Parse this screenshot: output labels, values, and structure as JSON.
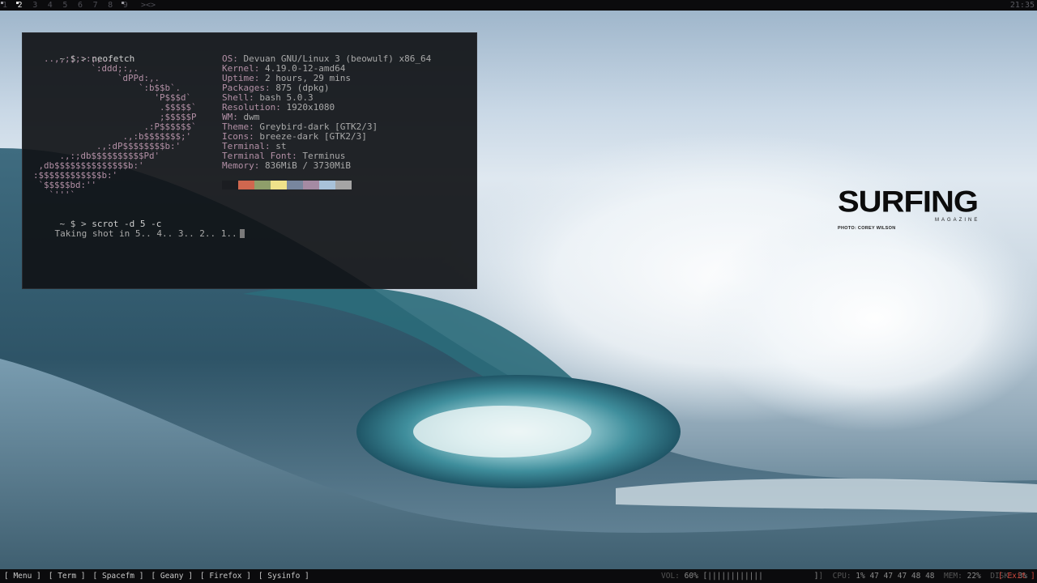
{
  "topbar": {
    "tags": [
      "1",
      "2",
      "3",
      "4",
      "5",
      "6",
      "7",
      "8",
      "9"
    ],
    "active_tag": "2",
    "layout_symbol": "><>",
    "clock": "21:35"
  },
  "wallpaper": {
    "brand": "SURFING",
    "brand_sub": "MAGAZINE",
    "credit": "PHOTO: COREY WILSON"
  },
  "terminal": {
    "prompt": {
      "tilde": "~",
      "dollar": "$",
      "arrow": ">"
    },
    "command1": "neofetch",
    "ascii_art": "  ..,,;;;::;,..\n           `:ddd;:,.\n                `dPPd:,.\n                    `:b$$b`.\n                       'P$$$d`\n                        .$$$$$`\n                        ;$$$$$P\n                     .:P$$$$$$`\n                 .,:b$$$$$$$;'\n            .,:dP$$$$$$$$b:'\n     .,:;db$$$$$$$$$$Pd'\n ,db$$$$$$$$$$$$$$b:'\n:$$$$$$$$$$$$b:'\n `$$$$$bd:''\n   `'''`",
    "info": [
      {
        "key": "OS",
        "value": "Devuan GNU/Linux 3 (beowulf) x86_64"
      },
      {
        "key": "Kernel",
        "value": "4.19.0-12-amd64"
      },
      {
        "key": "Uptime",
        "value": "2 hours, 29 mins"
      },
      {
        "key": "Packages",
        "value": "875 (dpkg)"
      },
      {
        "key": "Shell",
        "value": "bash 5.0.3"
      },
      {
        "key": "Resolution",
        "value": "1920x1080"
      },
      {
        "key": "WM",
        "value": "dwm"
      },
      {
        "key": "Theme",
        "value": "Greybird-dark [GTK2/3]"
      },
      {
        "key": "Icons",
        "value": "breeze-dark [GTK2/3]"
      },
      {
        "key": "Terminal",
        "value": "st"
      },
      {
        "key": "Terminal Font",
        "value": "Terminus"
      },
      {
        "key": "Memory",
        "value": "836MiB / 3730MiB"
      }
    ],
    "swatch_colors": [
      "#1b1d21",
      "#d0674f",
      "#8f9e6a",
      "#efe28a",
      "#78869e",
      "#a58aa3",
      "#a8c2d9",
      "#a5a5a5"
    ],
    "command2": "scrot -d 5 -c",
    "output2": "Taking shot in 5.. 4.. 3.. 2.. 1.."
  },
  "bottombar": {
    "launchers": [
      "[ Menu ]",
      "[ Term ]",
      "[ Spacefm ]",
      "[ Geany ]",
      "[ Firefox ]",
      "[ Sysinfo ]"
    ],
    "vol_label": "VOL:",
    "vol_value": "60% [||||||||||||           ]",
    "cpu_label": "CPU:",
    "cpu_value": "1% 47 47 47 48 48",
    "mem_label": "MEM:",
    "mem_value": "22%",
    "disk_label": "DISK:",
    "disk_value": "3%",
    "exit_label": "[ Exit ]"
  }
}
